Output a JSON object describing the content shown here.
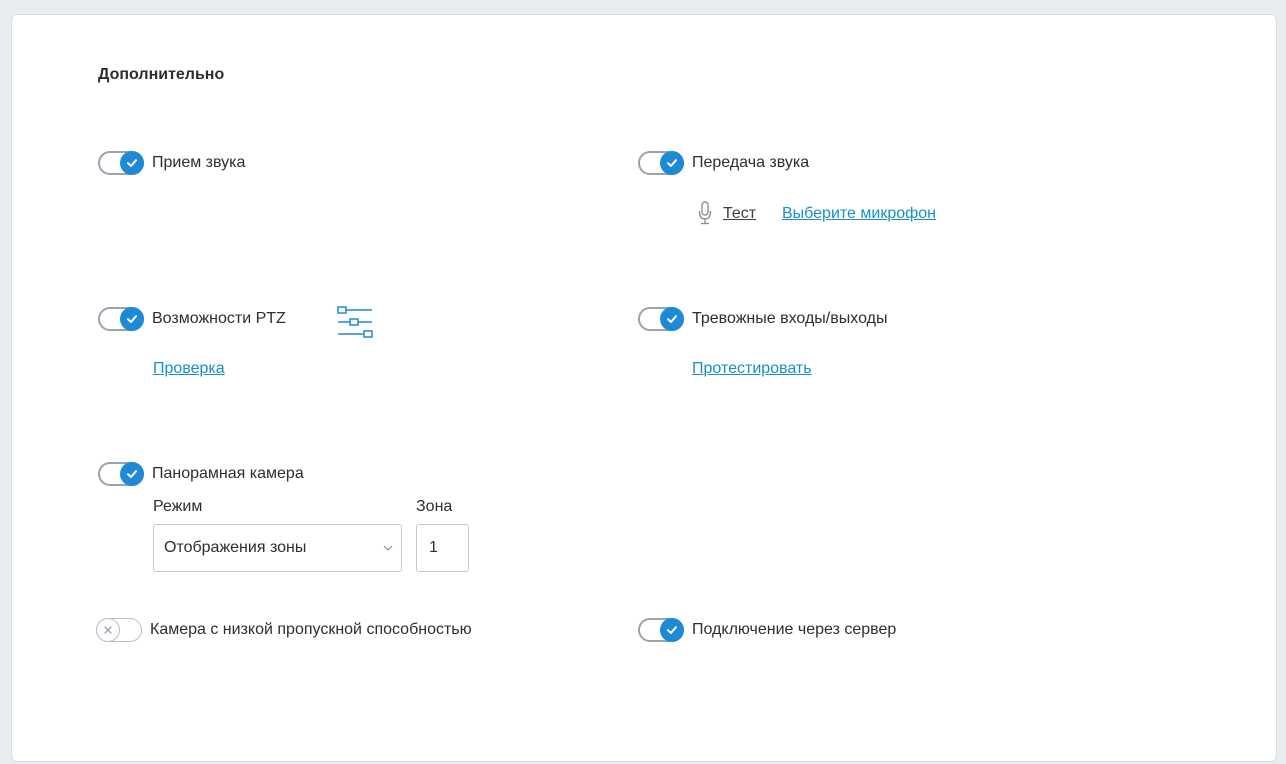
{
  "section": {
    "title": "Дополнительно"
  },
  "toggles": {
    "sound_receive": {
      "label": "Прием звука",
      "state": "on"
    },
    "sound_transmit": {
      "label": "Передача звука",
      "state": "on"
    },
    "ptz": {
      "label": "Возможности PTZ",
      "state": "on"
    },
    "alarm_io": {
      "label": "Тревожные входы/выходы",
      "state": "on"
    },
    "panoramic": {
      "label": "Панорамная камера",
      "state": "on"
    },
    "low_bandwidth": {
      "label": "Камера с низкой пропускной способностью",
      "state": "off"
    },
    "via_server": {
      "label": "Подключение через сервер",
      "state": "on"
    }
  },
  "microphone": {
    "test_label": "Тест",
    "select_label": "Выберите микрофон"
  },
  "ptz": {
    "check_link": "Проверка"
  },
  "alarm_io": {
    "test_link": "Протестировать"
  },
  "panoramic": {
    "mode_label": "Режим",
    "mode_value": "Отображения зоны",
    "zone_label": "Зона",
    "zone_value": "1"
  },
  "colors": {
    "accent": "#1e8ad6",
    "link": "#1591c7",
    "toggle_off_border": "#b9c0c8"
  },
  "icons": [
    "check-icon",
    "close-icon",
    "microphone-icon",
    "ptz-settings-icon",
    "chevron-down-icon"
  ]
}
